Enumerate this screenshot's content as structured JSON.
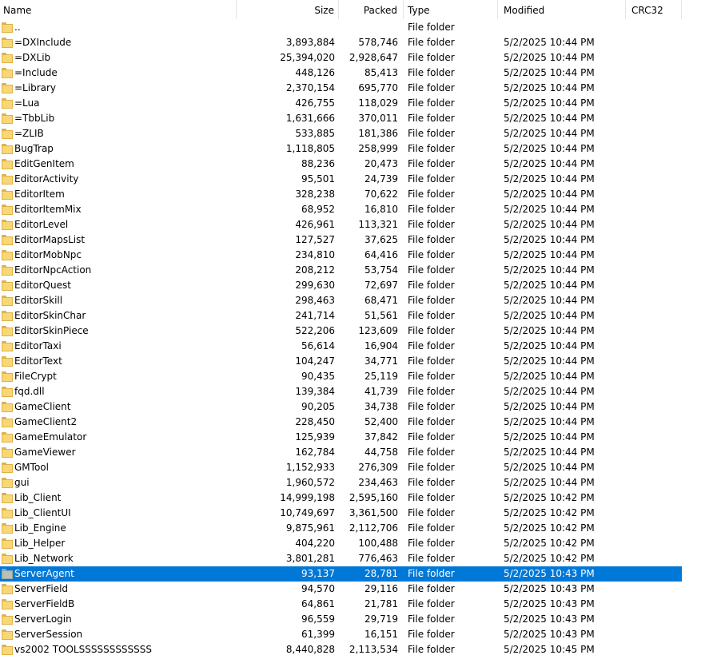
{
  "columns": {
    "name": "Name",
    "size": "Size",
    "packed": "Packed",
    "type": "Type",
    "modified": "Modified",
    "crc": "CRC32"
  },
  "sort_indicator": "^",
  "selected_index": 36,
  "rows": [
    {
      "name": "..",
      "size": "",
      "packed": "",
      "type": "File folder",
      "modified": "",
      "crc": ""
    },
    {
      "name": "=DXInclude",
      "size": "3,893,884",
      "packed": "578,746",
      "type": "File folder",
      "modified": "5/2/2025 10:44 PM",
      "crc": ""
    },
    {
      "name": "=DXLib",
      "size": "25,394,020",
      "packed": "2,928,647",
      "type": "File folder",
      "modified": "5/2/2025 10:44 PM",
      "crc": ""
    },
    {
      "name": "=Include",
      "size": "448,126",
      "packed": "85,413",
      "type": "File folder",
      "modified": "5/2/2025 10:44 PM",
      "crc": ""
    },
    {
      "name": "=Library",
      "size": "2,370,154",
      "packed": "695,770",
      "type": "File folder",
      "modified": "5/2/2025 10:44 PM",
      "crc": ""
    },
    {
      "name": "=Lua",
      "size": "426,755",
      "packed": "118,029",
      "type": "File folder",
      "modified": "5/2/2025 10:44 PM",
      "crc": ""
    },
    {
      "name": "=TbbLib",
      "size": "1,631,666",
      "packed": "370,011",
      "type": "File folder",
      "modified": "5/2/2025 10:44 PM",
      "crc": ""
    },
    {
      "name": "=ZLIB",
      "size": "533,885",
      "packed": "181,386",
      "type": "File folder",
      "modified": "5/2/2025 10:44 PM",
      "crc": ""
    },
    {
      "name": "BugTrap",
      "size": "1,118,805",
      "packed": "258,999",
      "type": "File folder",
      "modified": "5/2/2025 10:44 PM",
      "crc": ""
    },
    {
      "name": "EditGenItem",
      "size": "88,236",
      "packed": "20,473",
      "type": "File folder",
      "modified": "5/2/2025 10:44 PM",
      "crc": ""
    },
    {
      "name": "EditorActivity",
      "size": "95,501",
      "packed": "24,739",
      "type": "File folder",
      "modified": "5/2/2025 10:44 PM",
      "crc": ""
    },
    {
      "name": "EditorItem",
      "size": "328,238",
      "packed": "70,622",
      "type": "File folder",
      "modified": "5/2/2025 10:44 PM",
      "crc": ""
    },
    {
      "name": "EditorItemMix",
      "size": "68,952",
      "packed": "16,810",
      "type": "File folder",
      "modified": "5/2/2025 10:44 PM",
      "crc": ""
    },
    {
      "name": "EditorLevel",
      "size": "426,961",
      "packed": "113,321",
      "type": "File folder",
      "modified": "5/2/2025 10:44 PM",
      "crc": ""
    },
    {
      "name": "EditorMapsList",
      "size": "127,527",
      "packed": "37,625",
      "type": "File folder",
      "modified": "5/2/2025 10:44 PM",
      "crc": ""
    },
    {
      "name": "EditorMobNpc",
      "size": "234,810",
      "packed": "64,416",
      "type": "File folder",
      "modified": "5/2/2025 10:44 PM",
      "crc": ""
    },
    {
      "name": "EditorNpcAction",
      "size": "208,212",
      "packed": "53,754",
      "type": "File folder",
      "modified": "5/2/2025 10:44 PM",
      "crc": ""
    },
    {
      "name": "EditorQuest",
      "size": "299,630",
      "packed": "72,697",
      "type": "File folder",
      "modified": "5/2/2025 10:44 PM",
      "crc": ""
    },
    {
      "name": "EditorSkill",
      "size": "298,463",
      "packed": "68,471",
      "type": "File folder",
      "modified": "5/2/2025 10:44 PM",
      "crc": ""
    },
    {
      "name": "EditorSkinChar",
      "size": "241,714",
      "packed": "51,561",
      "type": "File folder",
      "modified": "5/2/2025 10:44 PM",
      "crc": ""
    },
    {
      "name": "EditorSkinPiece",
      "size": "522,206",
      "packed": "123,609",
      "type": "File folder",
      "modified": "5/2/2025 10:44 PM",
      "crc": ""
    },
    {
      "name": "EditorTaxi",
      "size": "56,614",
      "packed": "16,904",
      "type": "File folder",
      "modified": "5/2/2025 10:44 PM",
      "crc": ""
    },
    {
      "name": "EditorText",
      "size": "104,247",
      "packed": "34,771",
      "type": "File folder",
      "modified": "5/2/2025 10:44 PM",
      "crc": ""
    },
    {
      "name": "FileCrypt",
      "size": "90,435",
      "packed": "25,119",
      "type": "File folder",
      "modified": "5/2/2025 10:44 PM",
      "crc": ""
    },
    {
      "name": "fqd.dll",
      "size": "139,384",
      "packed": "41,739",
      "type": "File folder",
      "modified": "5/2/2025 10:44 PM",
      "crc": ""
    },
    {
      "name": "GameClient",
      "size": "90,205",
      "packed": "34,738",
      "type": "File folder",
      "modified": "5/2/2025 10:44 PM",
      "crc": ""
    },
    {
      "name": "GameClient2",
      "size": "228,450",
      "packed": "52,400",
      "type": "File folder",
      "modified": "5/2/2025 10:44 PM",
      "crc": ""
    },
    {
      "name": "GameEmulator",
      "size": "125,939",
      "packed": "37,842",
      "type": "File folder",
      "modified": "5/2/2025 10:44 PM",
      "crc": ""
    },
    {
      "name": "GameViewer",
      "size": "162,784",
      "packed": "44,758",
      "type": "File folder",
      "modified": "5/2/2025 10:44 PM",
      "crc": ""
    },
    {
      "name": "GMTool",
      "size": "1,152,933",
      "packed": "276,309",
      "type": "File folder",
      "modified": "5/2/2025 10:44 PM",
      "crc": ""
    },
    {
      "name": "gui",
      "size": "1,960,572",
      "packed": "234,463",
      "type": "File folder",
      "modified": "5/2/2025 10:44 PM",
      "crc": ""
    },
    {
      "name": "Lib_Client",
      "size": "14,999,198",
      "packed": "2,595,160",
      "type": "File folder",
      "modified": "5/2/2025 10:42 PM",
      "crc": ""
    },
    {
      "name": "Lib_ClientUI",
      "size": "10,749,697",
      "packed": "3,361,500",
      "type": "File folder",
      "modified": "5/2/2025 10:42 PM",
      "crc": ""
    },
    {
      "name": "Lib_Engine",
      "size": "9,875,961",
      "packed": "2,112,706",
      "type": "File folder",
      "modified": "5/2/2025 10:42 PM",
      "crc": ""
    },
    {
      "name": "Lib_Helper",
      "size": "404,220",
      "packed": "100,488",
      "type": "File folder",
      "modified": "5/2/2025 10:42 PM",
      "crc": ""
    },
    {
      "name": "Lib_Network",
      "size": "3,801,281",
      "packed": "776,463",
      "type": "File folder",
      "modified": "5/2/2025 10:42 PM",
      "crc": ""
    },
    {
      "name": "ServerAgent",
      "size": "93,137",
      "packed": "28,781",
      "type": "File folder",
      "modified": "5/2/2025 10:43 PM",
      "crc": ""
    },
    {
      "name": "ServerField",
      "size": "94,570",
      "packed": "29,116",
      "type": "File folder",
      "modified": "5/2/2025 10:43 PM",
      "crc": ""
    },
    {
      "name": "ServerFieldB",
      "size": "64,861",
      "packed": "21,781",
      "type": "File folder",
      "modified": "5/2/2025 10:43 PM",
      "crc": ""
    },
    {
      "name": "ServerLogin",
      "size": "96,559",
      "packed": "29,719",
      "type": "File folder",
      "modified": "5/2/2025 10:43 PM",
      "crc": ""
    },
    {
      "name": "ServerSession",
      "size": "61,399",
      "packed": "16,151",
      "type": "File folder",
      "modified": "5/2/2025 10:43 PM",
      "crc": ""
    },
    {
      "name": "vs2002 TOOLSSSSSSSSSSSS",
      "size": "8,440,828",
      "packed": "2,113,534",
      "type": "File folder",
      "modified": "5/2/2025 10:45 PM",
      "crc": ""
    }
  ],
  "colors": {
    "selection": "#0078d7",
    "folder": "#f8d775"
  },
  "icons": {
    "folder": "folder-icon",
    "sort": "sort-ascending-icon"
  }
}
